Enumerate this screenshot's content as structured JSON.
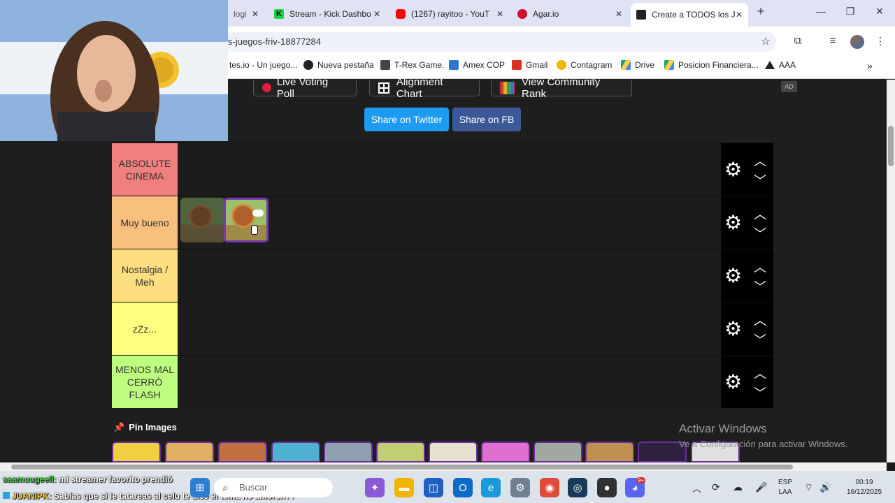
{
  "browser": {
    "tabs": [
      {
        "label": "logi",
        "favicon_color": "#4a6ad8"
      },
      {
        "label": "Stream - Kick Dashbo",
        "favicon_color": "#1dd14a"
      },
      {
        "label": "(1267) rayitoo - YouT",
        "favicon_color": "#ff0000"
      },
      {
        "label": "Agar.io",
        "favicon_color": "#d0102a"
      },
      {
        "label": "Create a TODOS los J",
        "favicon_color": "#222222",
        "active": true
      }
    ],
    "address": "s-juegos-friv-18877284",
    "bookmarks": [
      {
        "label": "tes.io - Un juego..."
      },
      {
        "label": "Nueva pestaña",
        "icon": "globe-icon"
      },
      {
        "label": "T-Rex Game.",
        "icon": "dino-icon"
      },
      {
        "label": "Amex COP",
        "icon": "amex-icon",
        "color": "#2e77d0"
      },
      {
        "label": "Gmail",
        "icon": "gmail-icon",
        "color": "#d93025"
      },
      {
        "label": "Contagram",
        "icon": "contagram-icon",
        "color": "#f2b400"
      },
      {
        "label": "Drive",
        "icon": "drive-icon",
        "color": "#1fa463"
      },
      {
        "label": "Posicion Financiera...",
        "icon": "drive-icon",
        "color": "#1fa463"
      },
      {
        "label": "AAA",
        "icon": "aaa-icon"
      }
    ]
  },
  "page": {
    "top_buttons": [
      {
        "label": "Live Voting Poll",
        "icon": "record-icon"
      },
      {
        "label": "Alignment Chart",
        "icon": "grid-icon"
      },
      {
        "label": "View Community Rank",
        "icon": "rank-grid-icon"
      }
    ],
    "share_twitter": "Share on Twitter",
    "share_fb": "Share on FB",
    "ad_label": "AD",
    "tiers": [
      {
        "label": "ABSOLUTE CINEMA",
        "color": "#f07f7f"
      },
      {
        "label": "Muy bueno",
        "color": "#f9bf7f"
      },
      {
        "label": "Nostalgia / Meh",
        "color": "#fddf7f"
      },
      {
        "label": "zZz...",
        "color": "#feff7f"
      },
      {
        "label": "MENOS MAL CERRÓ FLASH",
        "color": "#bfff7f"
      }
    ],
    "pin_images_label": "Pin Images"
  },
  "windows_activation": {
    "title": "Activar Windows",
    "subtitle": "Ve a Configuración para activar Windows."
  },
  "chat": [
    {
      "user": "saamuugeell",
      "message": ": mi streamer favorito prendió"
    },
    {
      "user": "JUANIPK",
      "message": ": Sabías que si le tatareas al celu te dice el tema no amorch??"
    }
  ],
  "taskbar": {
    "search_placeholder": "Buscar",
    "language": "ESP",
    "layout": "LAA",
    "time": "00:19",
    "date": "16/12/2025",
    "discord_badge": "9+"
  }
}
